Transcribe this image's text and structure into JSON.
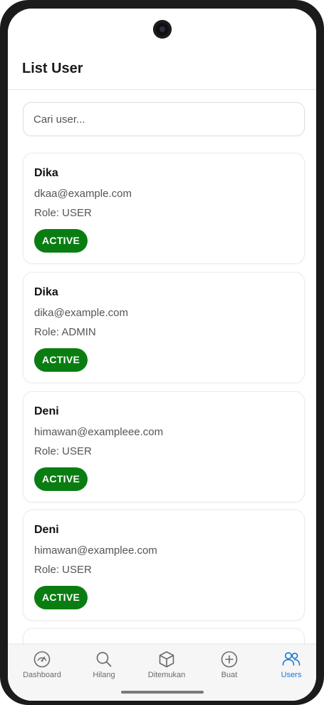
{
  "app_bar": {
    "title": "List User"
  },
  "search": {
    "placeholder": "Cari user..."
  },
  "users": [
    {
      "name": "Dika",
      "email": "dkaa@example.com",
      "role": "Role: USER",
      "status": "ACTIVE"
    },
    {
      "name": "Dika",
      "email": "dika@example.com",
      "role": "Role: ADMIN",
      "status": "ACTIVE"
    },
    {
      "name": "Deni",
      "email": "himawan@exampleee.com",
      "role": "Role: USER",
      "status": "ACTIVE"
    },
    {
      "name": "Deni",
      "email": "himawan@examplee.com",
      "role": "Role: USER",
      "status": "ACTIVE"
    }
  ],
  "bottom_nav": {
    "items": [
      {
        "label": "Dashboard",
        "icon": "speedometer-icon"
      },
      {
        "label": "Hilang",
        "icon": "search-icon"
      },
      {
        "label": "Ditemukan",
        "icon": "box-icon"
      },
      {
        "label": "Buat",
        "icon": "plus-circle-icon"
      },
      {
        "label": "Users",
        "icon": "users-icon",
        "active": true
      }
    ]
  },
  "colors": {
    "accent": "#1976d2",
    "status_active": "#0a7d12"
  }
}
